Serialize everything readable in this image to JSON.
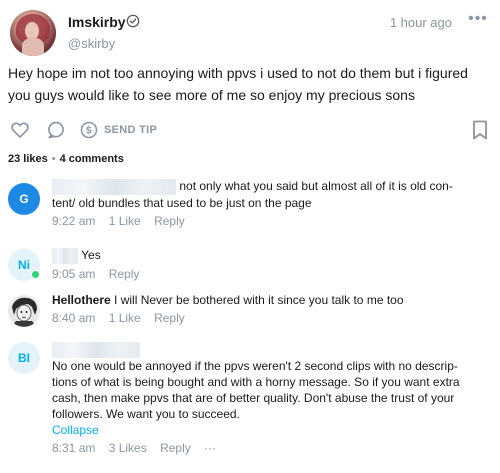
{
  "post": {
    "author": {
      "display_name": "Imskirby",
      "username": "@skirby",
      "verified_icon": "verified-badge-icon"
    },
    "time_ago": "1 hour ago",
    "more_icon": "more-dots-icon",
    "text": "Hey hope im not too annoying with ppvs i used to not do them but i figured you guys would like to see more of me so enjoy my precious sons",
    "actions": {
      "like_icon": "heart-icon",
      "comment_icon": "comment-bubble-icon",
      "tip_icon": "dollar-coin-icon",
      "send_tip_label": "SEND TIP",
      "bookmark_icon": "bookmark-icon"
    },
    "stats": {
      "likes": "23 likes",
      "separator": "•",
      "comments": "4 comments"
    }
  },
  "comments": [
    {
      "avatar_initial": "G",
      "avatar_color": "#1e88e5",
      "name_blurred": true,
      "text": "not only what you said but almost all of it is old con-tent/ old bundles that used to be just on the page",
      "text_line1": "not only what you said but almost all of it is old con-",
      "text_line2": "tent/ old bundles that used to be just on the page",
      "time": "9:22 am",
      "likes": "1 Like",
      "reply": "Reply"
    },
    {
      "avatar_initial": "Ni",
      "avatar_color": "#e3f2fb",
      "online": true,
      "name_blurred": true,
      "text": "Yes",
      "time": "9:05 am",
      "reply": "Reply"
    },
    {
      "avatar_image": "sketch-portrait-avatar",
      "name": "Hellothere",
      "text": "I will Never be bothered with it since you talk to me too",
      "time": "8:40 am",
      "likes": "1 Like",
      "reply": "Reply"
    },
    {
      "avatar_initial": "BI",
      "avatar_color": "#e3f2fb",
      "name_blurred": true,
      "text_lines": [
        "No one would be annoyed if the ppvs weren't 2 second clips with no descrip-",
        "tions of what is being bought and with a horny message. So if you want extra",
        "cash, then make ppvs that are of better quality. Don't abuse the trust of your",
        "followers. We want you to succeed."
      ],
      "collapse": "Collapse",
      "time": "8:31 am",
      "likes": "3 Likes",
      "reply": "Reply",
      "more": "···"
    }
  ],
  "colors": {
    "accent": "#00aff0",
    "muted": "#8a96a3",
    "online": "#2ed573"
  }
}
